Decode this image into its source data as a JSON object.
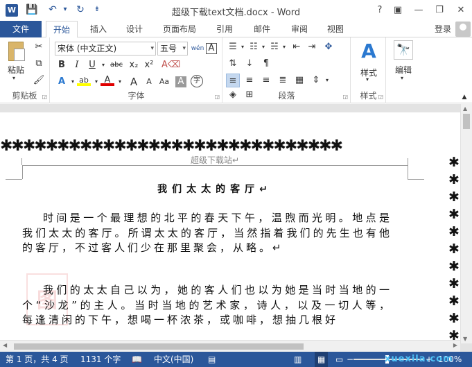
{
  "app": {
    "title": "超级下载text文档.docx - Word",
    "logo": "W"
  },
  "window_buttons": {
    "help": "?",
    "ribbon_options": "▣",
    "minimize": "—",
    "restore": "❐",
    "close": "✕"
  },
  "quick_access": {
    "save": "💾",
    "undo": "↶",
    "undo_dropdown": "▾",
    "redo": "↻",
    "customize": "⇟"
  },
  "tabs": {
    "file": "文件",
    "items": [
      "开始",
      "插入",
      "设计",
      "页面布局",
      "引用",
      "邮件",
      "审阅",
      "视图"
    ],
    "login": "登录"
  },
  "ribbon": {
    "clipboard": {
      "label": "剪贴板",
      "paste": "粘贴",
      "cut": "✂",
      "copy": "⧉",
      "format_painter": "🖌"
    },
    "font": {
      "label": "字体",
      "font_name": "宋体 (中文正文)",
      "font_size": "五号",
      "phonetic": "wén",
      "border": "A",
      "bold": "B",
      "italic": "I",
      "underline": "U",
      "strike": "abc",
      "subscript": "x₂",
      "superscript": "x²",
      "clear": "A⌫",
      "effects": "A",
      "highlight": "ab",
      "font_color": "A",
      "grow": "A",
      "shrink": "A",
      "case": "Aa",
      "char_shading": "A",
      "enclose": "字"
    },
    "paragraph": {
      "label": "段落"
    },
    "styles": {
      "label": "样式",
      "button": "样式",
      "icon": "A"
    },
    "editing": {
      "label": "编辑",
      "button": "编辑",
      "icon": "🔭"
    }
  },
  "document": {
    "header": "超级下载站↵",
    "title": "我们太太的客厅↵",
    "para1": "时间是一个最理想的北平的春天下午，温煦而光明。地点是我们太太的客厅。所谓太太的客厅，当然指着我们的先生也有他的客厅，不过客人们少在那里聚会，从略。↵",
    "para2": "我们的太太自己以为，她的客人们也以为她是当时当地的一个“沙龙”的主人。当时当地的艺术家，诗人，以及一切人等，每逢清闲的下午，想喝一杯浓茶，或咖啡，想抽几根好",
    "star": "✱",
    "watermark": "图"
  },
  "status": {
    "page": "第 1 页，共 4 页",
    "words": "1131 个字",
    "language": "中文(中国)",
    "zoom": "100%",
    "zoom_minus": "−",
    "zoom_plus": "+",
    "brand": "xuexila.com"
  }
}
